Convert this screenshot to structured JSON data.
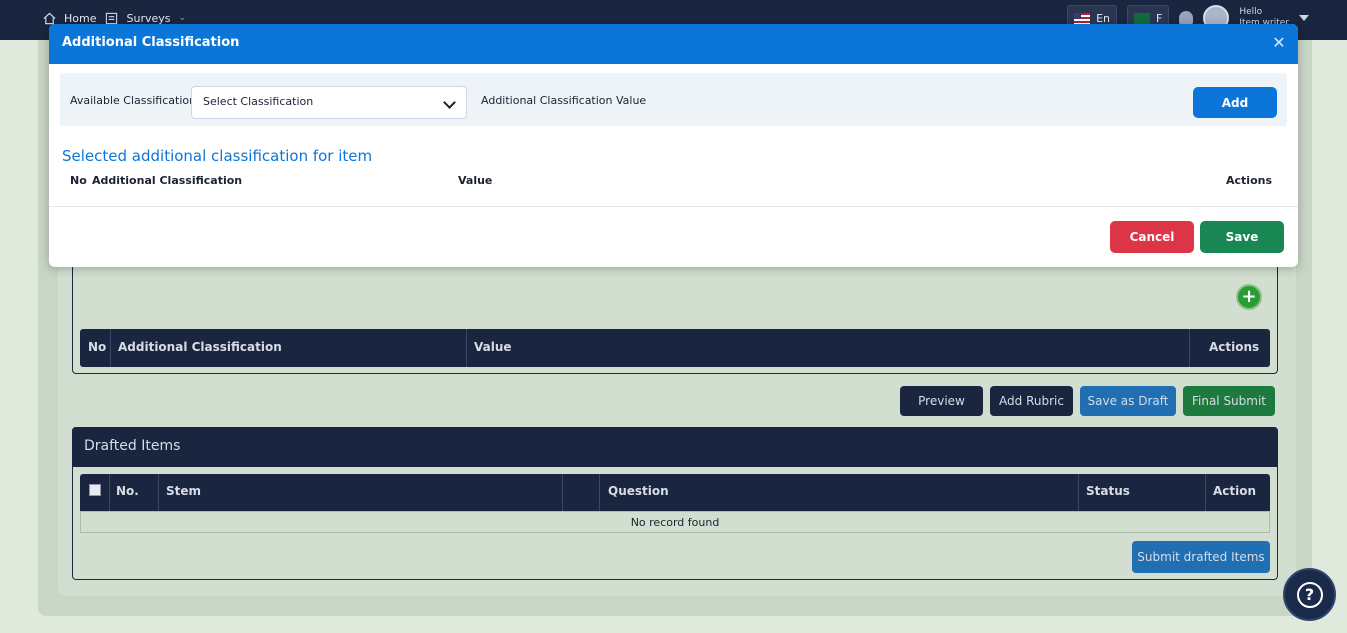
{
  "topbar": {
    "home_label": "Home",
    "surveys_label": "Surveys",
    "lang_en": "En",
    "lang_ar": "F",
    "hello": "Hello",
    "username": "Item writer"
  },
  "background": {
    "table_headers": [
      "No",
      "Additional Classification",
      "Value",
      "Actions"
    ],
    "buttons": {
      "preview": "Preview",
      "add_rubric": "Add Rubric",
      "save_draft": "Save as Draft",
      "final_submit": "Final Submit"
    },
    "drafted": {
      "title": "Drafted Items",
      "headers": [
        "No.",
        "Stem",
        "Question",
        "Status",
        "Action"
      ],
      "empty": "No record found",
      "submit": "Submit drafted Items"
    }
  },
  "modal": {
    "title": "Additional Classification",
    "available_label": "Available Classification:",
    "select_placeholder": "Select Classification",
    "value_label": "Additional Classification Value",
    "add_label": "Add",
    "selected_title": "Selected additional classification for item",
    "table_headers": {
      "no": "No",
      "classification": "Additional Classification",
      "value": "Value",
      "actions": "Actions"
    },
    "cancel_label": "Cancel",
    "save_label": "Save"
  },
  "colors": {
    "primary": "#0b76d8",
    "danger": "#dc3545",
    "success": "#198754",
    "navy": "#1a2540"
  }
}
